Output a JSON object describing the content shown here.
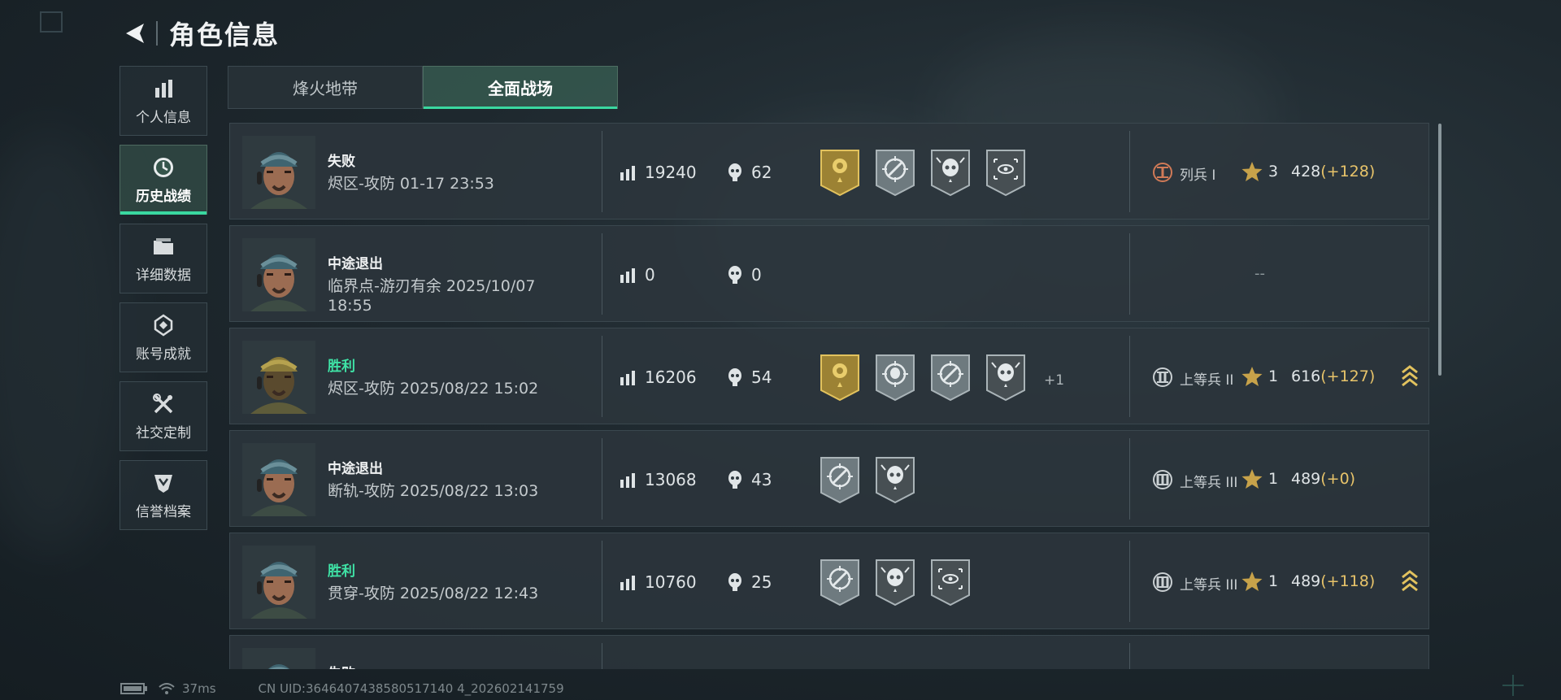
{
  "header": {
    "title": "角色信息"
  },
  "sidebar": {
    "items": [
      {
        "label": "个人信息",
        "icon": "bar-chart-icon",
        "active": false
      },
      {
        "label": "历史战绩",
        "icon": "clock-icon",
        "active": true
      },
      {
        "label": "详细数据",
        "icon": "folder-icon",
        "active": false
      },
      {
        "label": "账号成就",
        "icon": "achievement-icon",
        "active": false
      },
      {
        "label": "社交定制",
        "icon": "wrench-icon",
        "active": false
      },
      {
        "label": "信誉档案",
        "icon": "shield-icon",
        "active": false
      }
    ]
  },
  "tabs": [
    {
      "label": "烽火地带",
      "active": false
    },
    {
      "label": "全面战场",
      "active": true
    }
  ],
  "matches": [
    {
      "result": "失败",
      "win": false,
      "map": "烬区-攻防 01-17 23:53",
      "score": "19240",
      "kills": "62",
      "badges": [
        "gold-medal-icon",
        "crosshair-medal-icon",
        "skull-medal-icon",
        "eye-medal-icon"
      ],
      "extra": "",
      "rank_icon": "rank-I-icon",
      "rank": "列兵 I",
      "stars": "3",
      "points": "428",
      "delta": "(+128)",
      "promo": false
    },
    {
      "result": "中途退出",
      "win": false,
      "map": "临界点-游刃有余 2025/10/07 18:55",
      "score": "0",
      "kills": "0",
      "badges": [],
      "extra": "",
      "rank_icon": "",
      "rank": "",
      "stars": "",
      "points": "",
      "delta": "",
      "dash": "--",
      "promo": false
    },
    {
      "result": "胜利",
      "win": true,
      "map": "烬区-攻防 2025/08/22 15:02",
      "score": "16206",
      "kills": "54",
      "badges": [
        "gold-medal-icon",
        "skull-target-medal-icon",
        "crosshair-medal-icon",
        "skull-medal-icon"
      ],
      "extra": "+1",
      "rank_icon": "rank-II-icon",
      "rank": "上等兵 II",
      "stars": "1",
      "points": "616",
      "delta": "(+127)",
      "promo": true
    },
    {
      "result": "中途退出",
      "win": false,
      "map": "断轨-攻防 2025/08/22 13:03",
      "score": "13068",
      "kills": "43",
      "badges": [
        "crosshair-medal-icon",
        "skull-medal-icon"
      ],
      "extra": "",
      "rank_icon": "rank-III-icon",
      "rank": "上等兵 III",
      "stars": "1",
      "points": "489",
      "delta": "(+0)",
      "promo": false
    },
    {
      "result": "胜利",
      "win": true,
      "map": "贯穿-攻防 2025/08/22 12:43",
      "score": "10760",
      "kills": "25",
      "badges": [
        "crosshair-medal-icon",
        "skull-medal-icon",
        "eye-medal-icon"
      ],
      "extra": "",
      "rank_icon": "rank-III-icon",
      "rank": "上等兵 III",
      "stars": "1",
      "points": "489",
      "delta": "(+118)",
      "promo": true
    },
    {
      "result": "失败",
      "win": false,
      "map": "",
      "score": "",
      "kills": "",
      "badges": [],
      "extra": "",
      "rank_icon": "",
      "rank": "",
      "stars": "",
      "points": "",
      "delta": "",
      "promo": false
    }
  ],
  "footer": {
    "ping": "37ms",
    "uid": "CN UID:3646407438580517140 4_202602141759"
  },
  "colors": {
    "accent": "#3ad8a0",
    "win": "#3fe3a6",
    "delta": "#e8c46a",
    "gold": "#c7a24a"
  }
}
